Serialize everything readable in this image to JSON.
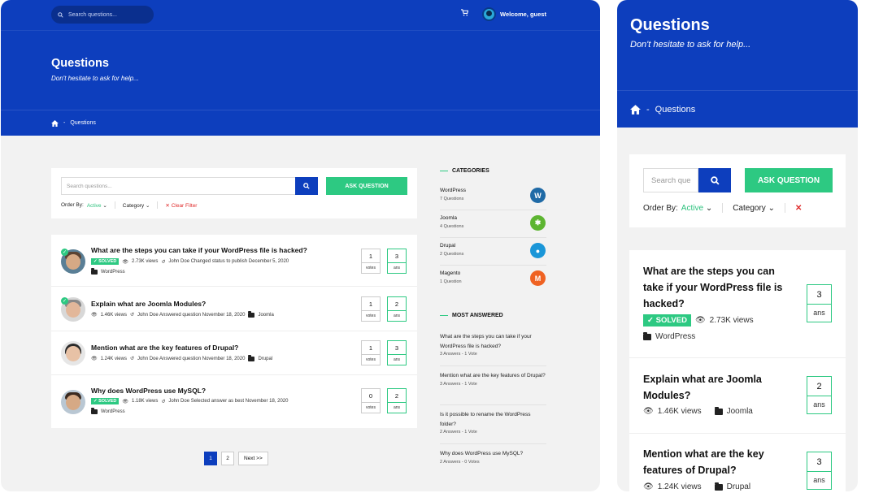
{
  "desktop": {
    "topbar": {
      "search_placeholder": "Search questions...",
      "cart_icon": "cart-icon",
      "welcome": "Welcome, guest"
    },
    "hero": {
      "title": "Questions",
      "subtitle": "Don't hesitate to ask for help..."
    },
    "breadcrumb": {
      "home_icon": "home-icon",
      "separator": "-",
      "current": "Questions"
    },
    "filter": {
      "search_placeholder": "Search questions...",
      "ask_label": "ASK QUESTION",
      "order_by_label": "Order By:",
      "order_by_value": "Active",
      "category_label": "Category",
      "clear_label": "Clear Filter"
    },
    "questions": [
      {
        "title": "What are the steps you can take if your WordPress file is hacked?",
        "solved": "SOLVED",
        "views": "2.73K views",
        "activity": "John Doe Changed status to publish December 5, 2020",
        "category": "WordPress",
        "votes": "1",
        "votes_label": "votes",
        "answers": "3",
        "answers_label": "ans"
      },
      {
        "title": "Explain what are Joomla Modules?",
        "views": "1.46K views",
        "activity": "John Doe Answered question November 18, 2020",
        "category": "Joomla",
        "votes": "1",
        "votes_label": "votes",
        "answers": "2",
        "answers_label": "ans"
      },
      {
        "title": "Mention what are the key features of Drupal?",
        "views": "1.24K views",
        "activity": "John Doe Answered question November 18, 2020",
        "category": "Drupal",
        "votes": "1",
        "votes_label": "votes",
        "answers": "3",
        "answers_label": "ans"
      },
      {
        "title": "Why does WordPress use MySQL?",
        "solved": "SOLVED",
        "views": "1.18K views",
        "activity": "John Doe Selected answer as best November 18, 2020",
        "category": "WordPress",
        "votes": "0",
        "votes_label": "votes",
        "answers": "2",
        "answers_label": "ans"
      }
    ],
    "pagination": {
      "pages": [
        "1",
        "2"
      ],
      "next": "Next >>"
    },
    "categories": {
      "heading": "CATEGORIES",
      "items": [
        {
          "name": "WordPress",
          "count": "7 Questions",
          "icon": "wordpress-icon",
          "glyph": "W",
          "color": "#1f6aa6"
        },
        {
          "name": "Joomla",
          "count": "4 Questions",
          "icon": "joomla-icon",
          "glyph": "✱",
          "color": "#5db531"
        },
        {
          "name": "Drupal",
          "count": "2 Questions",
          "icon": "drupal-icon",
          "glyph": "●",
          "color": "#1a96d8"
        },
        {
          "name": "Magento",
          "count": "1 Question",
          "icon": "magento-icon",
          "glyph": "M",
          "color": "#ef6222"
        }
      ]
    },
    "most_answered": {
      "heading": "MOST ANSWERED",
      "items": [
        {
          "title": "What are the steps you can take if your WordPress file is hacked?",
          "stats": "3 Answers - 1 Vote"
        },
        {
          "title": "Mention what are the key features of Drupal?",
          "stats": "3 Answers - 1 Vote"
        },
        {
          "title": "Is it possible to rename the WordPress folder?",
          "stats": "2 Answers - 1 Vote"
        },
        {
          "title": "Why does WordPress use MySQL?",
          "stats": "2 Answers - 0 Votes"
        }
      ]
    }
  },
  "mobile": {
    "hero": {
      "title": "Questions",
      "subtitle": "Don't hesitate to ask for help..."
    },
    "breadcrumb": {
      "separator": "-",
      "current": "Questions"
    },
    "filter": {
      "search_placeholder": "Search que",
      "ask_label": "ASK QUESTION",
      "order_by_label": "Order By:",
      "order_by_value": "Active",
      "category_label": "Category"
    },
    "questions": [
      {
        "title": "What are the steps you can take if your WordPress file is hacked?",
        "solved": "SOLVED",
        "views": "2.73K views",
        "category": "WordPress",
        "answers": "3",
        "answers_label": "ans"
      },
      {
        "title": "Explain what are Joomla Modules?",
        "views": "1.46K views",
        "category": "Joomla",
        "answers": "2",
        "answers_label": "ans"
      },
      {
        "title": "Mention what are the key features of Drupal?",
        "views": "1.24K views",
        "category": "Drupal",
        "answers": "3",
        "answers_label": "ans"
      }
    ]
  },
  "colors": {
    "brand_blue": "#0d3ebd",
    "accent_green": "#2dc982",
    "clear_red": "#e02b2b"
  }
}
